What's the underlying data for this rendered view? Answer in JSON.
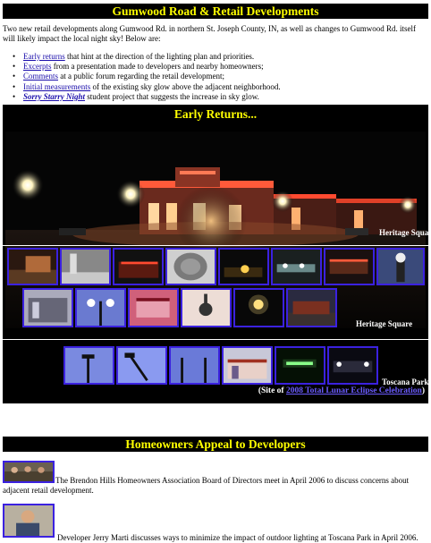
{
  "header": {
    "title": "Gumwood Road & Retail Developments"
  },
  "intro": {
    "text": "Two new retail developments along Gumwood Rd. in northern St. Joseph County, IN, as well as changes to Gumwood Rd. itself will likely impact the local night sky!  Below are:"
  },
  "bullets": [
    {
      "link": "Early returns",
      "rest": " that hint at the direction of the lighting plan and priorities."
    },
    {
      "link": "Excerpts",
      "rest": " from a presentation made to developers and nearby homeowners;"
    },
    {
      "link": "Comments",
      "rest": " at a public forum regarding the retail development;"
    },
    {
      "link": "Initial measurements",
      "rest": " of the existing sky glow above the adjacent neighborhood."
    },
    {
      "link": "Sorry Starry Night",
      "rest": " student project that suggests the increase in sky glow."
    }
  ],
  "early": {
    "title": "Early Returns...",
    "caption_hero": "Heritage Square",
    "caption_row2": "Heritage Square",
    "caption_toscana": "Toscana Park",
    "site_prefix": "(Site of ",
    "site_link": "2008 Total Lunar Eclipse Celebration",
    "site_suffix": ")"
  },
  "appeal": {
    "title": "Homeowners Appeal to Developers",
    "item1": "The Brendon Hills Homeowners Association Board of Directors meet in April 2006 to discuss concerns about adjacent retail development.",
    "item2": "Developer Jerry Marti discusses ways to minimize the impact of outdoor lighting at Toscana Park in April 2006."
  },
  "colors": {
    "banner_bg": "#000000",
    "banner_text": "#ffff00",
    "thumb_border": "#3b21e0",
    "link": "#1a0dab"
  }
}
